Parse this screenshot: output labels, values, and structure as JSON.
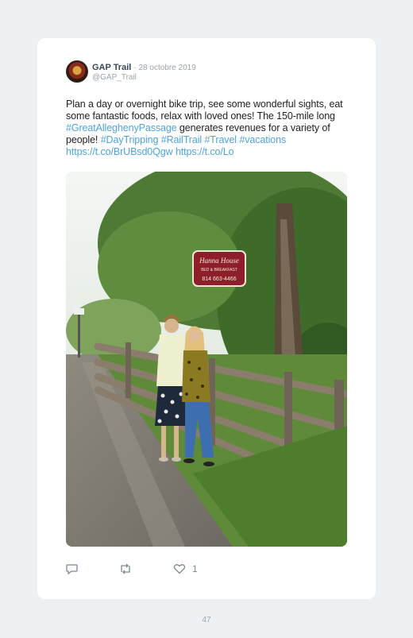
{
  "tweet": {
    "author": "GAP Trail",
    "date": "· 28 octobre 2019",
    "handle": "@GAP_Trail",
    "text_parts": [
      {
        "text": "Plan a day or overnight bike trip, see some wonderful sights, eat some fantastic foods, relax with loved ones! The 150-mile long ",
        "link": false
      },
      {
        "text": "#GreatAlleghenyPassage",
        "link": true
      },
      {
        "text": " generates revenues for a variety of people! ",
        "link": false
      },
      {
        "text": "#DayTripping",
        "link": true
      },
      {
        "text": " ",
        "link": false
      },
      {
        "text": "#RailTrail",
        "link": true
      },
      {
        "text": " ",
        "link": false
      },
      {
        "text": "#Travel",
        "link": true
      },
      {
        "text": " ",
        "link": false
      },
      {
        "text": "#vacations",
        "link": true
      },
      {
        "text": " ",
        "link": false
      },
      {
        "text": "https://t.co/BrUBsd0Qgw",
        "link": true
      },
      {
        "text": " ",
        "link": false
      },
      {
        "text": "https://t.co/Lo",
        "link": true
      }
    ],
    "photo": {
      "sign_line1": "Hanna House",
      "sign_line2": "BED & BREAKFAST",
      "sign_phone": "814 663-4466"
    },
    "actions": {
      "likes": "1"
    }
  },
  "page_number": "47",
  "colors": {
    "link": "#4da3e0",
    "page_bg": "#eef1f4",
    "card_bg": "#ffffff"
  }
}
